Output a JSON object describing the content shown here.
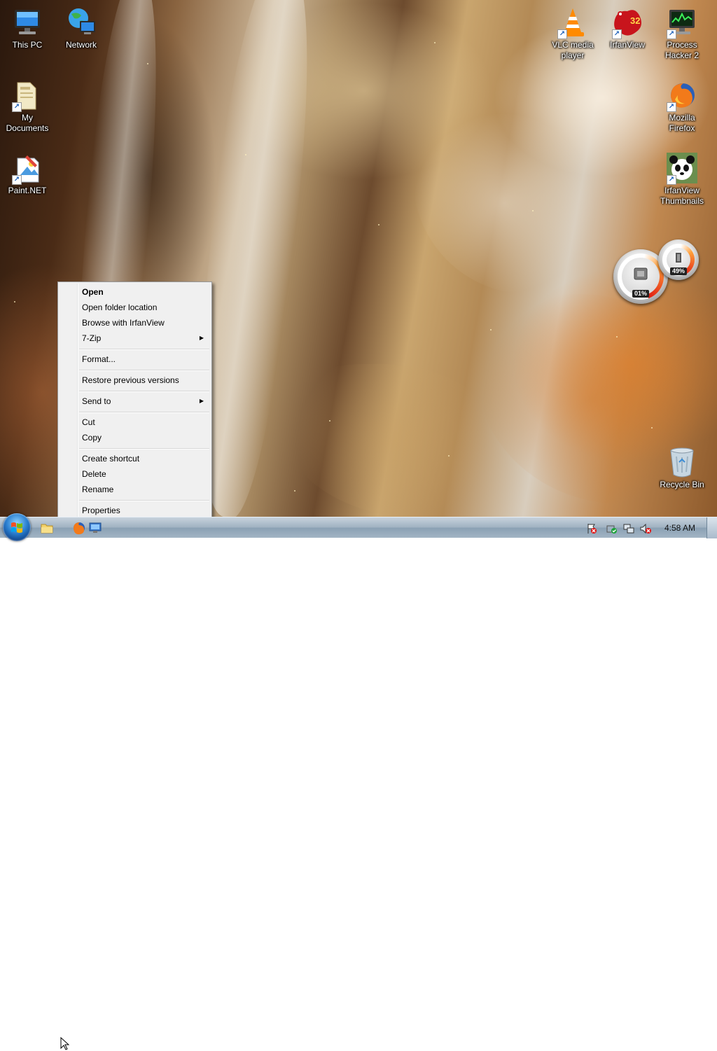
{
  "desktop": {
    "icons_left": [
      {
        "id": "this-pc",
        "label": "This PC"
      },
      {
        "id": "network",
        "label": "Network"
      },
      {
        "id": "my-documents",
        "label": "My Documents"
      },
      {
        "id": "paint-net",
        "label": "Paint.NET"
      }
    ],
    "icons_right": [
      {
        "id": "vlc",
        "label": "VLC media player"
      },
      {
        "id": "irfanview",
        "label": "IrfanView",
        "badge": "32"
      },
      {
        "id": "process-hacker",
        "label": "Process Hacker 2"
      },
      {
        "id": "firefox",
        "label": "Mozilla Firefox"
      },
      {
        "id": "irfanview-thumbnails",
        "label": "IrfanView Thumbnails"
      },
      {
        "id": "recycle-bin",
        "label": "Recycle Bin"
      }
    ]
  },
  "gadgets": {
    "cpu_readout": "01%",
    "memory_readout": "49%"
  },
  "context_menu": {
    "items": [
      {
        "label": "Open",
        "bold": true
      },
      {
        "label": "Open folder location"
      },
      {
        "label": "Browse with IrfanView"
      },
      {
        "label": "7-Zip",
        "submenu": true
      },
      {
        "label": "Format..."
      },
      {
        "label": "Restore previous versions"
      },
      {
        "label": "Send to",
        "submenu": true
      },
      {
        "label": "Cut"
      },
      {
        "label": "Copy"
      },
      {
        "label": "Create shortcut"
      },
      {
        "label": "Delete"
      },
      {
        "label": "Rename"
      },
      {
        "label": "Properties"
      }
    ]
  },
  "taskbar": {
    "pinned": [
      "explorer-icon",
      "firefox-icon",
      "remote-desktop-icon"
    ],
    "tray": [
      "action-center-icon",
      "security-icon",
      "network-icon",
      "volume-muted-icon"
    ],
    "clock": "4:58 AM"
  },
  "colors": {
    "menu_bg": "#f0f0f0",
    "taskbar": "#9fb1c1",
    "start_orb": "#2a7fd0"
  }
}
